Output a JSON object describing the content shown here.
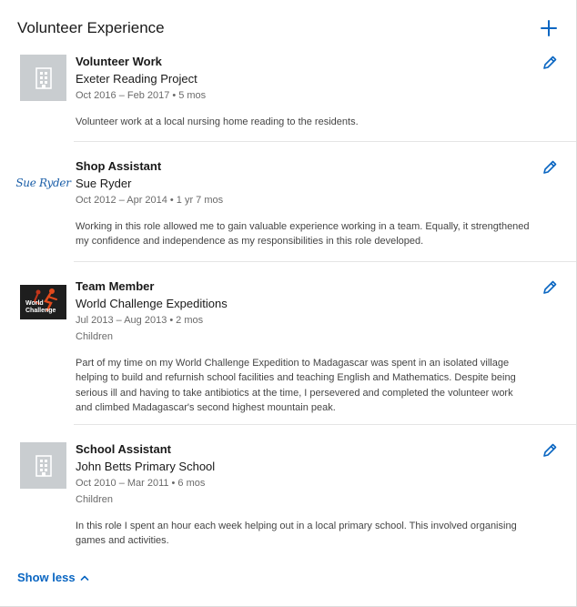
{
  "section": {
    "title": "Volunteer Experience",
    "show_less": "Show less"
  },
  "colors": {
    "accent": "#0a66c2",
    "placeholder_logo": "#c9cdd0",
    "divider": "#e5e5e5"
  },
  "entries": [
    {
      "role": "Volunteer Work",
      "organization": "Exeter Reading Project",
      "dates": "Oct 2016 – Feb 2017",
      "duration": "5 mos",
      "cause": "",
      "description": "Volunteer work at a local nursing home reading to the residents.",
      "logo": "building-icon"
    },
    {
      "role": "Shop Assistant",
      "organization": "Sue Ryder",
      "dates": "Oct 2012 – Apr 2014",
      "duration": "1 yr 7 mos",
      "cause": "",
      "description": "Working in this role allowed me to gain valuable experience working in a team. Equally, it strengthened my confidence and independence as my responsibilities in this role developed.",
      "logo_text": "Sue Ryder"
    },
    {
      "role": "Team Member",
      "organization": "World Challenge Expeditions",
      "dates": "Jul 2013 – Aug 2013",
      "duration": "2 mos",
      "cause": "Children",
      "description": "Part of my time on my World Challenge Expedition to Madagascar was spent in an isolated village helping to build and refurnish school facilities and teaching English and Mathematics. Despite being serious ill and having to take antibiotics at the time, I persevered and completed the volunteer work and climbed Madagascar's second highest mountain peak.",
      "logo_text_line1": "World",
      "logo_text_line2": "Challenge"
    },
    {
      "role": "School Assistant",
      "organization": "John Betts Primary School",
      "dates": "Oct 2010 – Mar 2011",
      "duration": "6 mos",
      "cause": "Children",
      "description": "In this role I spent an hour each week helping out in a local primary school. This involved organising games and activities.",
      "logo": "building-icon"
    }
  ]
}
